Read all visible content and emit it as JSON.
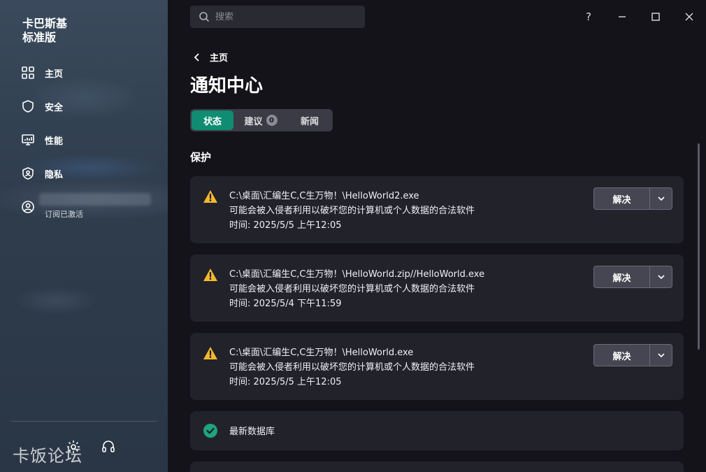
{
  "sidebar": {
    "brand_line1": "卡巴斯基",
    "brand_line2": "标准版",
    "items": [
      {
        "label": "主页",
        "icon": "grid-icon"
      },
      {
        "label": "安全",
        "icon": "shield-icon"
      },
      {
        "label": "性能",
        "icon": "monitor-icon"
      },
      {
        "label": "隐私",
        "icon": "privacy-shield-icon"
      }
    ],
    "account_sub": "订阅已激活",
    "watermark": "卡饭论坛"
  },
  "search": {
    "placeholder": "搜索"
  },
  "window": {
    "help": "?"
  },
  "breadcrumb": {
    "label": "主页"
  },
  "page": {
    "title": "通知中心"
  },
  "tabs": [
    {
      "label": "状态",
      "active": true
    },
    {
      "label": "建议",
      "badge": "0"
    },
    {
      "label": "新闻"
    }
  ],
  "section": {
    "title": "保护"
  },
  "threats": [
    {
      "path": "C:\\桌面\\汇编生C,C生万物！\\HelloWorld2.exe",
      "desc": "可能会被入侵者利用以破坏您的计算机或个人数据的合法软件",
      "time": "时间: 2025/5/5 上午12:05",
      "action": "解决"
    },
    {
      "path": "C:\\桌面\\汇编生C,C生万物！\\HelloWorld.zip//HelloWorld.exe",
      "desc": "可能会被入侵者利用以破坏您的计算机或个人数据的合法软件",
      "time": "时间: 2025/5/4 下午11:59",
      "action": "解决"
    },
    {
      "path": "C:\\桌面\\汇编生C,C生万物！\\HelloWorld.exe",
      "desc": "可能会被入侵者利用以破坏您的计算机或个人数据的合法软件",
      "time": "时间: 2025/5/5 上午12:05",
      "action": "解决"
    }
  ],
  "status_ok": {
    "label": "最新数据库"
  },
  "colors": {
    "accent": "#0f8c72",
    "warning": "#f5b82e",
    "ok": "#1fa37f"
  }
}
